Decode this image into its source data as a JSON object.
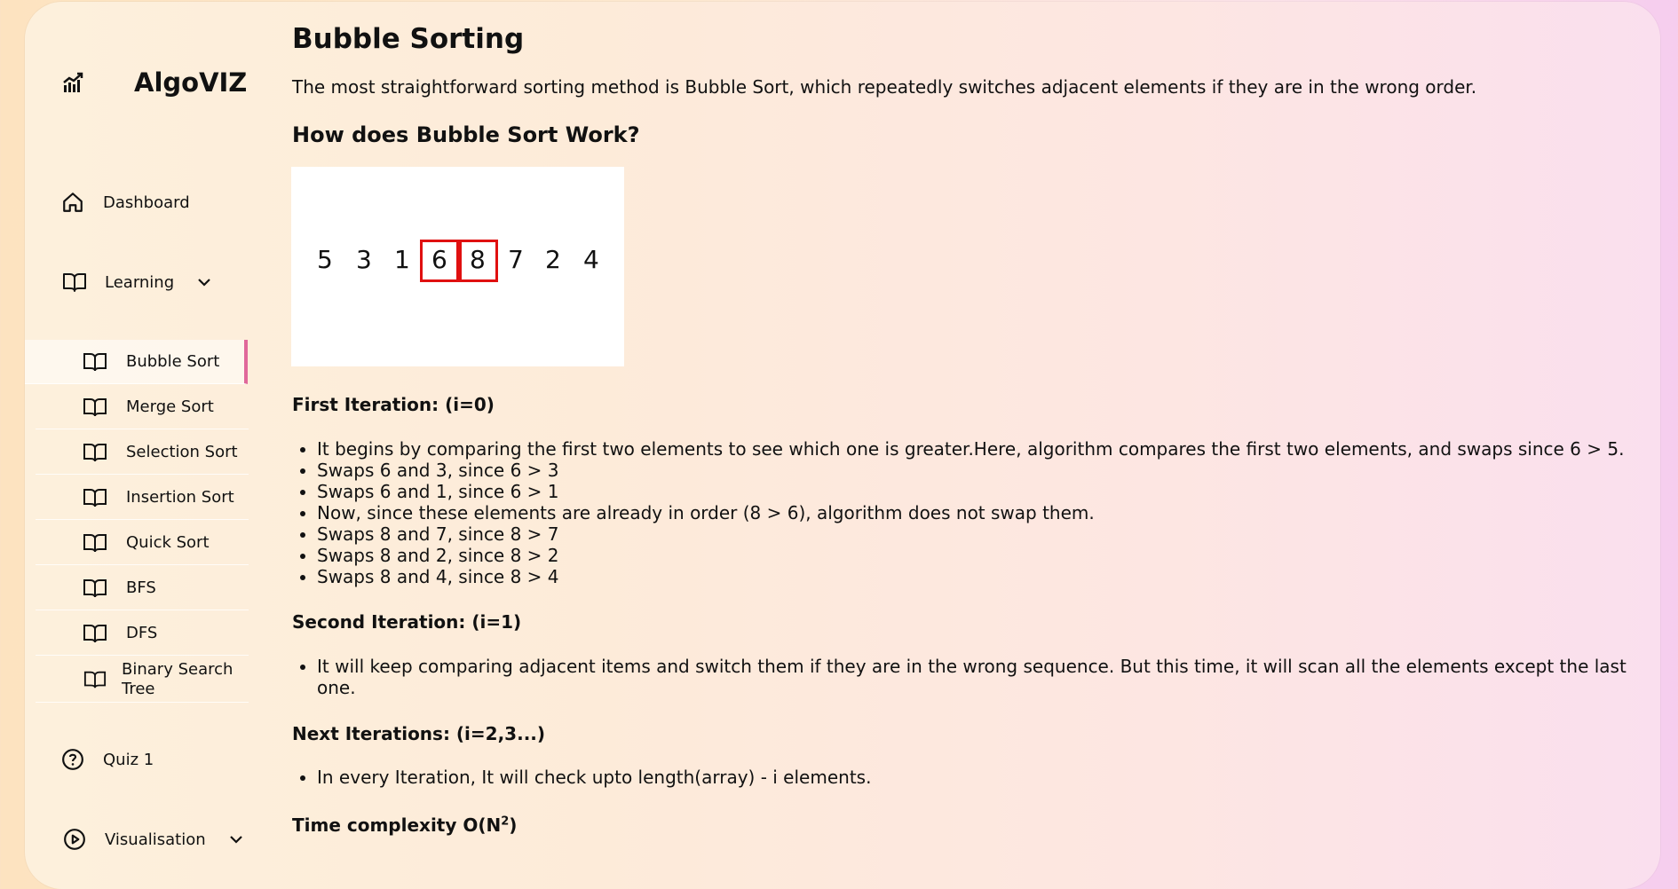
{
  "app": {
    "name": "AlgoVIZ"
  },
  "sidebar": {
    "dashboard": "Dashboard",
    "learning": "Learning",
    "items": [
      {
        "label": "Bubble Sort"
      },
      {
        "label": "Merge Sort"
      },
      {
        "label": "Selection Sort"
      },
      {
        "label": "Insertion Sort"
      },
      {
        "label": "Quick Sort"
      },
      {
        "label": "BFS"
      },
      {
        "label": "DFS"
      },
      {
        "label": "Binary Search Tree"
      }
    ],
    "quiz": "Quiz 1",
    "visualisation": "Visualisation"
  },
  "page": {
    "title": "Bubble Sorting",
    "intro": "The most straightforward sorting method is Bubble Sort, which repeatedly switches adjacent elements if they are in the wrong order.",
    "how_heading": "How does Bubble Sort Work?",
    "demo": {
      "numbers": [
        "5",
        "3",
        "1",
        "6",
        "8",
        "7",
        "2",
        "4"
      ],
      "highlighted": [
        "6",
        "8"
      ],
      "highlight_color": "#e01010"
    },
    "first_heading": "First Iteration: (i=0)",
    "first_points": [
      "It begins by comparing the first two elements to see which one is greater.Here, algorithm compares the first two elements, and swaps since 6 > 5.",
      "Swaps 6 and 3, since 6 > 3",
      "Swaps 6 and 1, since 6 > 1",
      "Now, since these elements are already in order (8 > 6), algorithm does not swap them.",
      "Swaps 8 and 7, since 8 > 7",
      "Swaps 8 and 2, since 8 > 2",
      "Swaps 8 and 4, since 8 > 4"
    ],
    "second_heading": "Second Iteration: (i=1)",
    "second_points": [
      "It will keep comparing adjacent items and switch them if they are in the wrong sequence. But this time, it will scan all the elements except the last one."
    ],
    "next_heading": "Next Iterations: (i=2,3...)",
    "next_points": [
      "In every Iteration, It will check upto length(array) - i elements."
    ],
    "complexity_heading": "Time complexity O(N",
    "complexity_sup": "2",
    "complexity_close": ")"
  },
  "colors": {
    "active_indicator": "#e0689a"
  }
}
